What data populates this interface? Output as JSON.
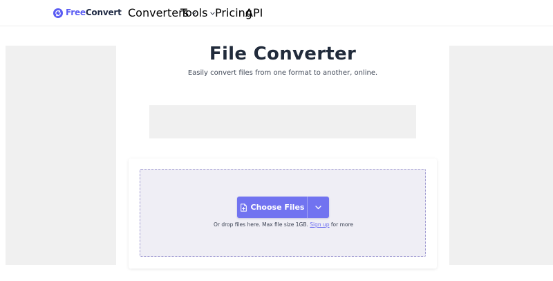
{
  "brand": {
    "name_part1": "Free",
    "name_part2": "Convert",
    "accent_color": "#5a5cf3"
  },
  "nav": {
    "items": [
      {
        "label": "Converters",
        "has_dropdown": true,
        "icon": "chevron-down-icon"
      },
      {
        "label": "Tools",
        "has_dropdown": true,
        "icon": "chevron-down-icon"
      },
      {
        "label": "Pricing",
        "has_dropdown": false
      },
      {
        "label": "API",
        "has_dropdown": false
      }
    ]
  },
  "hero": {
    "title": "File Converter",
    "subtitle": "Easily convert files from one format to another, online."
  },
  "upload": {
    "button_label": "Choose Files",
    "button_icon": "file-plus-icon",
    "dropdown_icon": "chevron-down-icon",
    "button_color": "#7173f0",
    "hint_prefix": "Or drop files here. Max file size 1GB.",
    "hint_link": "Sign up",
    "hint_suffix": "for more"
  }
}
